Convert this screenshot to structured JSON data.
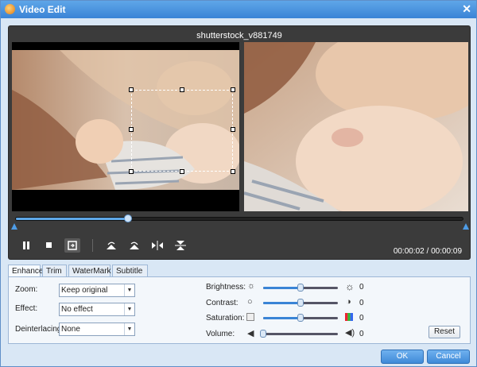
{
  "window": {
    "title": "Video Edit"
  },
  "player": {
    "filename": "shutterstock_v881749",
    "time_display": "00:00:02 / 00:00:09",
    "progress_fraction": 0.25
  },
  "controls": {
    "icons": [
      "pause-icon",
      "stop-icon",
      "crop-icon",
      "rotate-left-icon",
      "rotate-right-icon",
      "flip-horizontal-icon",
      "flip-vertical-icon"
    ]
  },
  "tabs": [
    {
      "label": "Enhance",
      "selected": true
    },
    {
      "label": "Trim",
      "selected": false
    },
    {
      "label": "WaterMark",
      "selected": false
    },
    {
      "label": "Subtitle",
      "selected": false
    }
  ],
  "enhance": {
    "zoom": {
      "label": "Zoom:",
      "value": "Keep original"
    },
    "effect": {
      "label": "Effect:",
      "value": "No effect"
    },
    "deinterlacing": {
      "label": "Deinterlacing:",
      "value": "None"
    },
    "brightness": {
      "label": "Brightness:",
      "value": "0",
      "level": 0.5
    },
    "contrast": {
      "label": "Contrast:",
      "value": "0",
      "level": 0.5
    },
    "saturation": {
      "label": "Saturation:",
      "value": "0",
      "level": 0.5
    },
    "volume": {
      "label": "Volume:",
      "value": "0",
      "level": 0.0
    },
    "reset_label": "Reset"
  },
  "footer": {
    "ok_label": "OK",
    "cancel_label": "Cancel"
  },
  "colors": {
    "accent": "#3a84d6",
    "player_bg": "#3b3b3b",
    "panel_bg": "#f3f7fb"
  }
}
